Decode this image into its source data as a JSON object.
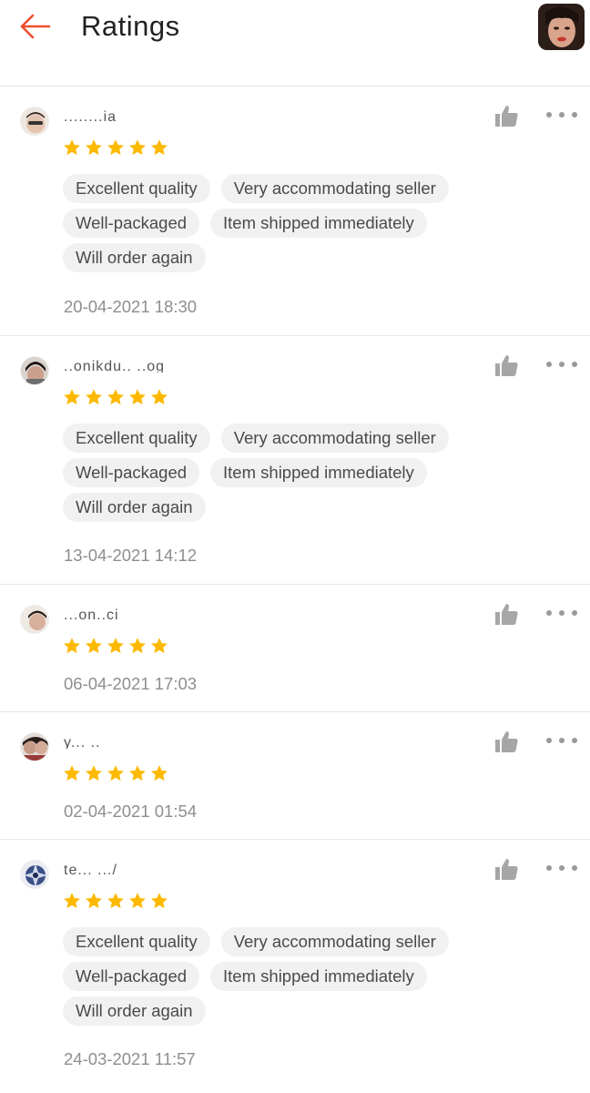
{
  "header": {
    "title": "Ratings",
    "back_icon": "arrow-left-icon",
    "accent_color": "#ee4d2d"
  },
  "star_color": "#fcb900",
  "reviews": [
    {
      "username": "........ia",
      "rating": 5,
      "tags": [
        "Excellent quality",
        "Very accommodating seller",
        "Well-packaged",
        "Item shipped immediately",
        "Will order again"
      ],
      "date": "20-04-2021 18:30"
    },
    {
      "username": "..onikdu.. ..og",
      "rating": 5,
      "tags": [
        "Excellent quality",
        "Very accommodating seller",
        "Well-packaged",
        "Item shipped immediately",
        "Will order again"
      ],
      "date": "13-04-2021 14:12"
    },
    {
      "username": "...on..ci",
      "rating": 5,
      "tags": [],
      "date": "06-04-2021 17:03"
    },
    {
      "username": "y...  ..",
      "rating": 5,
      "tags": [],
      "date": "02-04-2021 01:54"
    },
    {
      "username": "te... .../",
      "rating": 5,
      "tags": [
        "Excellent quality",
        "Very accommodating seller",
        "Well-packaged",
        "Item shipped immediately",
        "Will order again"
      ],
      "date": "24-03-2021 11:57"
    }
  ]
}
